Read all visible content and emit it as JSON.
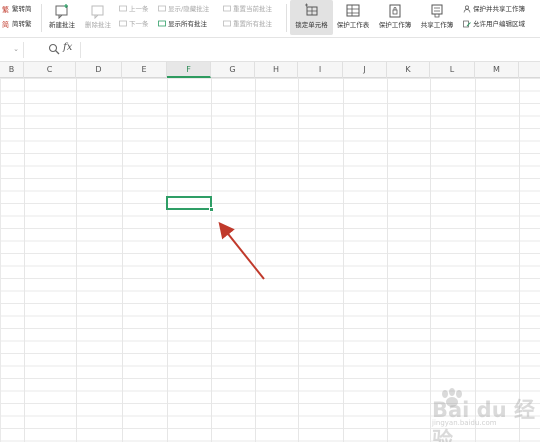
{
  "ribbon": {
    "left_group": [
      {
        "label": "繁转简",
        "icon": "convert-icon"
      },
      {
        "label": "简转繁",
        "icon": "convert-icon"
      }
    ],
    "new_comment": "新建批注",
    "delete_comment": "删除批注",
    "prev": "上一条",
    "next": "下一条",
    "show_hide_comment": "显示/隐藏批注",
    "show_all_comments": "显示所有批注",
    "reset_current_comment": "重置当前批注",
    "reset_all_comments": "重置所有批注",
    "lock_cell": "锁定单元格",
    "protect_sheet": "保护工作表",
    "protect_workbook": "保护工作簿",
    "share_workbook": "共享工作簿",
    "protect_and_share": "保护并共享工作簿",
    "allow_edit_ranges": "允许用户编辑区域"
  },
  "formula_bar": {
    "name_box": "",
    "fx": "fx",
    "value": ""
  },
  "columns": [
    "B",
    "C",
    "D",
    "E",
    "F",
    "G",
    "H",
    "I",
    "J",
    "K",
    "L",
    "M"
  ],
  "active_column": "F",
  "accent": "#2f9e66",
  "arrow_color": "#c0392b",
  "watermark": {
    "brand": "Bai du 经验",
    "sub": "jingyan.baidu.com"
  }
}
